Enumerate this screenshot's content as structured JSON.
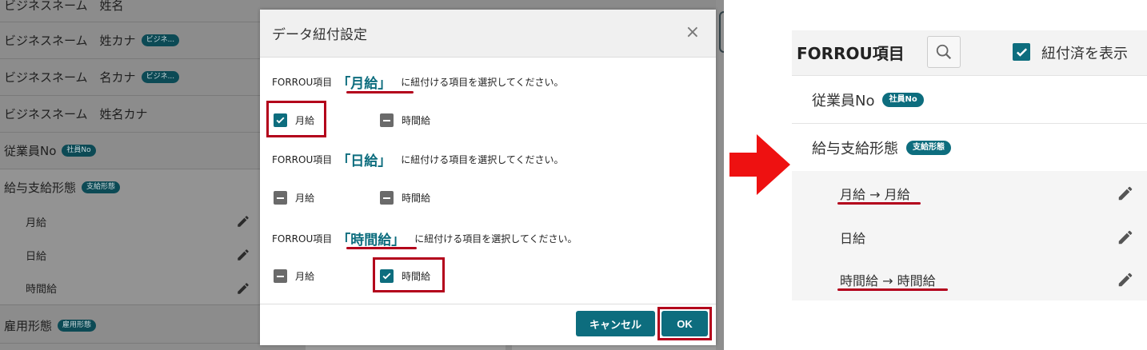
{
  "background_list": {
    "rows": [
      {
        "label": "ビジネスネーム　姓名",
        "badge": ""
      },
      {
        "label": "ビジネスネーム　姓カナ",
        "badge": "ビジネ..."
      },
      {
        "label": "ビジネスネーム　名カナ",
        "badge": "ビジネ..."
      },
      {
        "label": "ビジネスネーム　姓名カナ",
        "badge": ""
      },
      {
        "label": "従業員No",
        "badge": "社員No"
      },
      {
        "label": "給与支給形態",
        "badge": "支給形態"
      },
      {
        "label": "雇用形態",
        "badge": "雇用形態"
      }
    ],
    "sub_items": [
      "月給",
      "日給",
      "時間給"
    ]
  },
  "dialog": {
    "title": "データ紐付設定",
    "close_glyph": "×",
    "prefix": "FORROU項目",
    "suffix": "に紐付ける項目を選択してください。",
    "sections": [
      {
        "name": "「月給」",
        "options": [
          {
            "label": "月給",
            "state": "checked"
          },
          {
            "label": "時間給",
            "state": "indeterminate"
          }
        ]
      },
      {
        "name": "「日給」",
        "options": [
          {
            "label": "月給",
            "state": "indeterminate"
          },
          {
            "label": "時間給",
            "state": "indeterminate"
          }
        ]
      },
      {
        "name": "「時間給」",
        "options": [
          {
            "label": "月給",
            "state": "indeterminate"
          },
          {
            "label": "時間給",
            "state": "checked"
          }
        ]
      }
    ],
    "cancel_label": "キャンセル",
    "ok_label": "OK"
  },
  "result_panel": {
    "title": "FORROU項目",
    "show_linked_label": "紐付済を表示",
    "rows": [
      {
        "label": "従業員No",
        "badge": "社員No"
      },
      {
        "label": "給与支給形態",
        "badge": "支給形態"
      }
    ],
    "sub_items": [
      "月給 → 月給",
      "日給",
      "時間給 → 時間給"
    ]
  },
  "colors": {
    "accent": "#0d6d7e",
    "highlight_red": "#b3001b",
    "arrow_red": "#ee1111"
  }
}
